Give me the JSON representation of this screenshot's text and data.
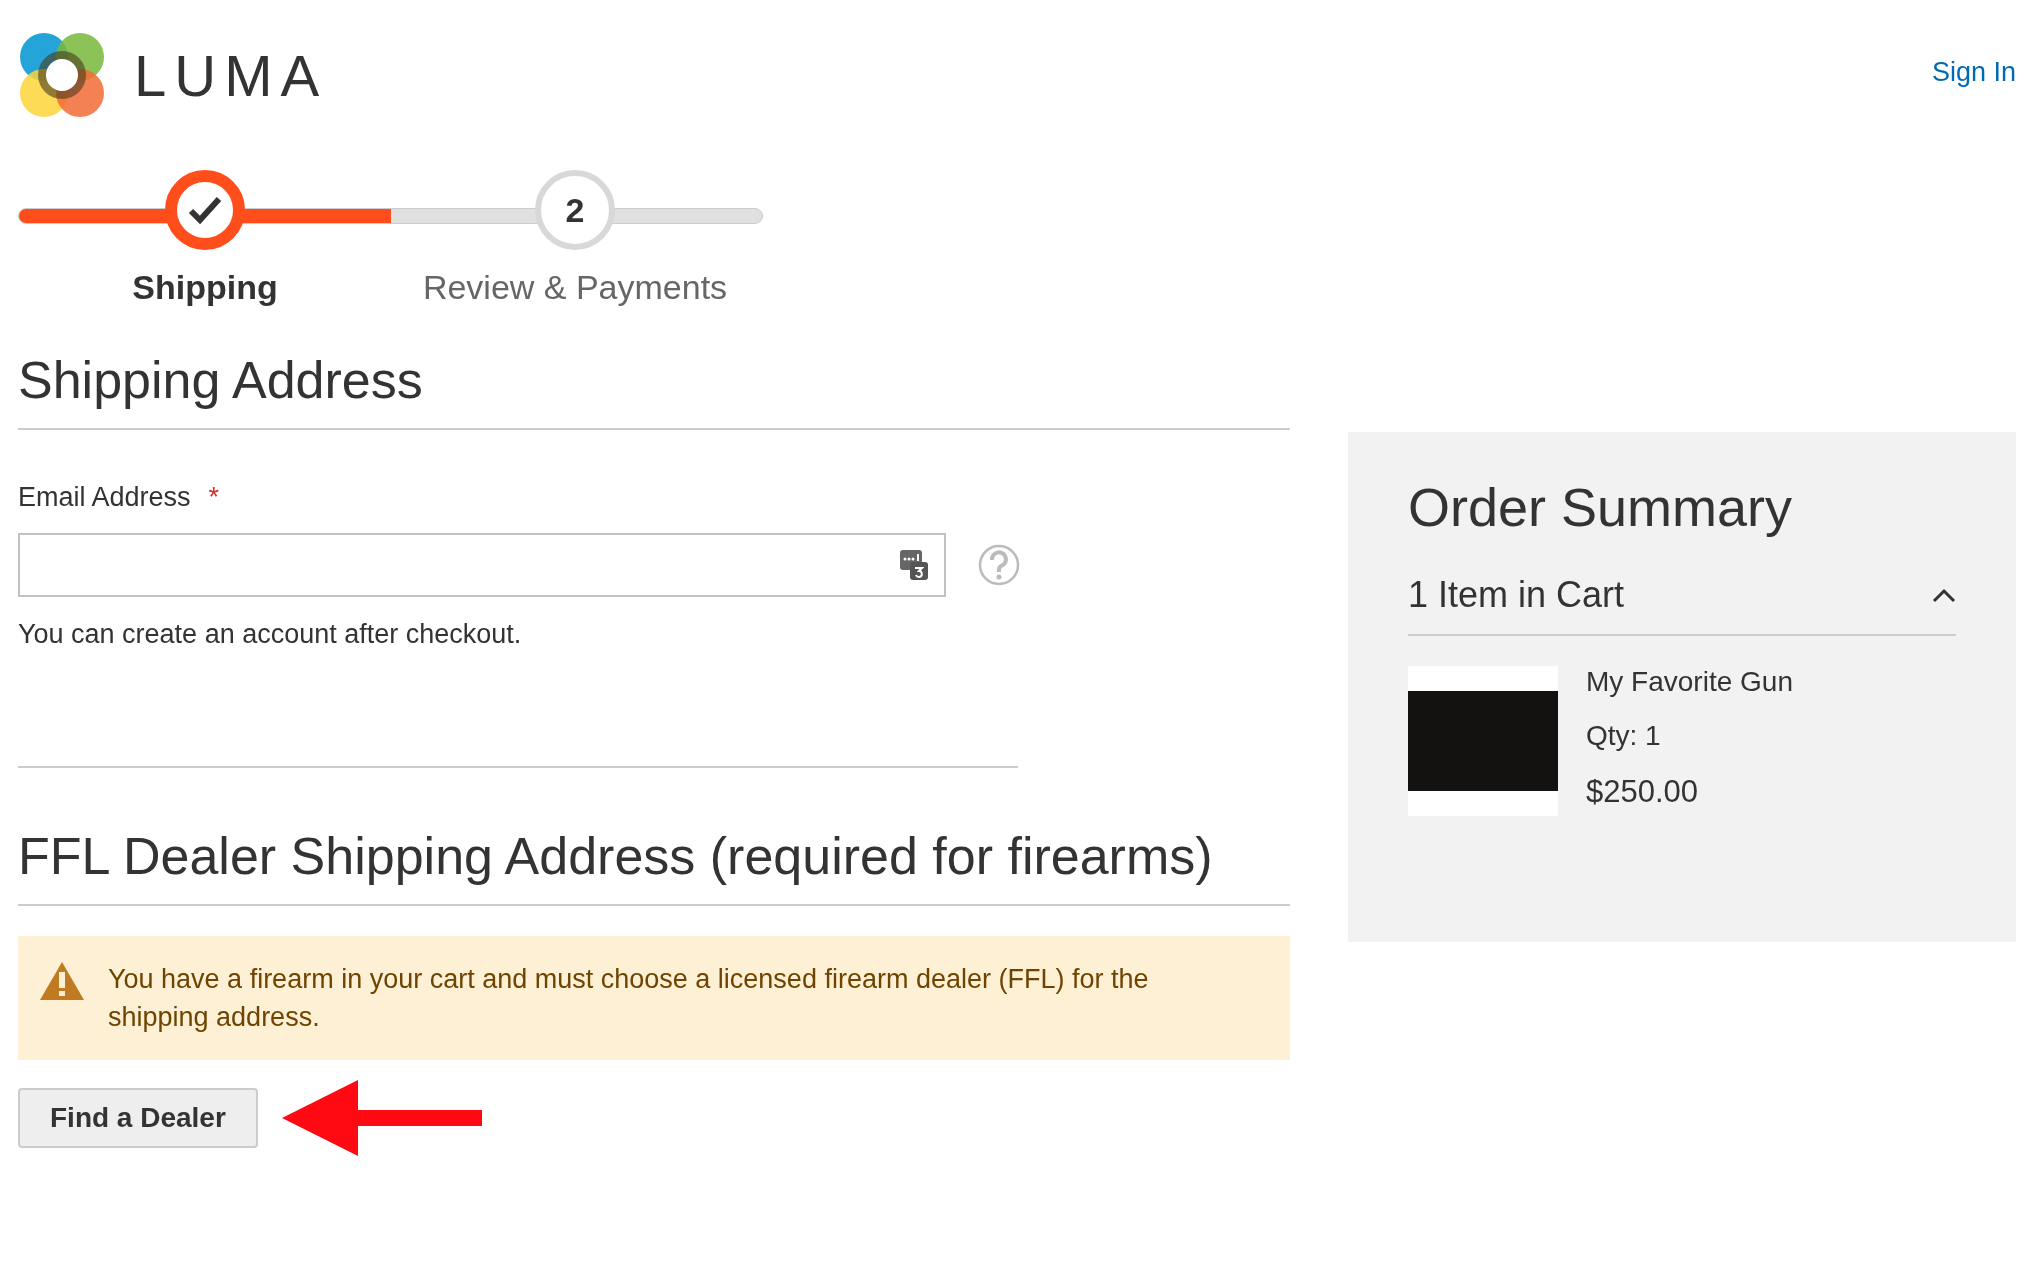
{
  "header": {
    "logo_text": "LUMA",
    "sign_in": "Sign In"
  },
  "progress": {
    "level": 0.5,
    "steps": [
      {
        "label": "Shipping",
        "selected": true,
        "complete": true
      },
      {
        "label": "Review & Payments",
        "number": "2",
        "selected": false,
        "complete": false
      }
    ]
  },
  "shipping_address": {
    "title": "Shipping Address",
    "email": {
      "label": "Email Address",
      "required_mark": "*"
    },
    "note": "You can create an account after checkout."
  },
  "ffl": {
    "title": "FFL Dealer Shipping Address (required for firearms)",
    "notice": "You have a firearm in your cart and must choose a licensed firearm dealer (FFL) for the shipping address.",
    "button": "Find a Dealer"
  },
  "order_summary": {
    "title": "Order Summary",
    "cart_count": "1 Item in Cart",
    "expanded": true,
    "items": [
      {
        "name": "My Favorite Gun",
        "qty": "Qty: 1",
        "price": "$250.00"
      }
    ]
  }
}
